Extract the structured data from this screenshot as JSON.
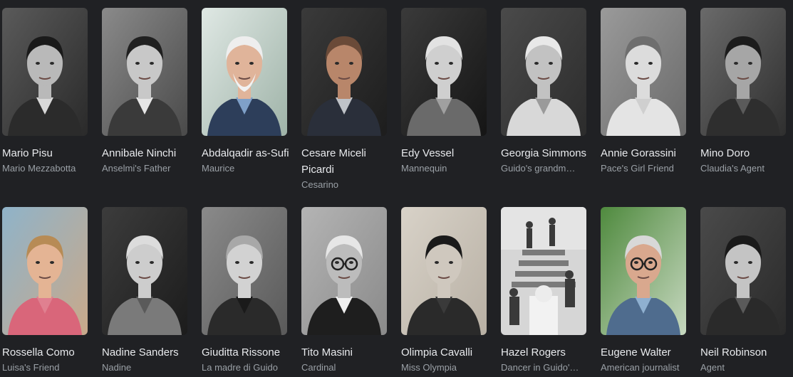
{
  "cast": [
    {
      "name": "Mario Pisu",
      "role": "Mario Mezzabotta",
      "photo": "portrait-man-dark-hair"
    },
    {
      "name": "Annibale Ninchi",
      "role": "Anselmi's Father",
      "photo": "portrait-man-vintage"
    },
    {
      "name": "Abdalqadir as-Sufi",
      "role": "Maurice",
      "photo": "portrait-man-white-beard"
    },
    {
      "name": "Cesare Miceli Picardi",
      "role": "Cesarino",
      "photo": "portrait-man-bald"
    },
    {
      "name": "Edy Vessel",
      "role": "Mannequin",
      "photo": "portrait-woman-blonde"
    },
    {
      "name": "Georgia Simmons",
      "role": "Guido's grandm…",
      "photo": "portrait-old-woman"
    },
    {
      "name": "Annie Gorassini",
      "role": "Pace's Girl Friend",
      "photo": "portrait-woman-wavy-hair"
    },
    {
      "name": "Mino Doro",
      "role": "Claudia's Agent",
      "photo": "portrait-man-profile"
    },
    {
      "name": "Rossella Como",
      "role": "Luisa's Friend",
      "photo": "portrait-woman-color"
    },
    {
      "name": "Nadine Sanders",
      "role": "Nadine",
      "photo": "portrait-woman-smiling"
    },
    {
      "name": "Giuditta Rissone",
      "role": "La madre di Guido",
      "photo": "portrait-woman-curls"
    },
    {
      "name": "Tito Masini",
      "role": "Cardinal",
      "photo": "portrait-old-man-glasses"
    },
    {
      "name": "Olimpia Cavalli",
      "role": "Miss Olympia",
      "photo": "portrait-woman-long-hair"
    },
    {
      "name": "Hazel Rogers",
      "role": "Dancer in Guido'…",
      "photo": "scene-staircase"
    },
    {
      "name": "Eugene Walter",
      "role": "American journalist",
      "photo": "portrait-old-man-plaid"
    },
    {
      "name": "Neil Robinson",
      "role": "Agent",
      "photo": "portrait-man-short-hair"
    }
  ]
}
